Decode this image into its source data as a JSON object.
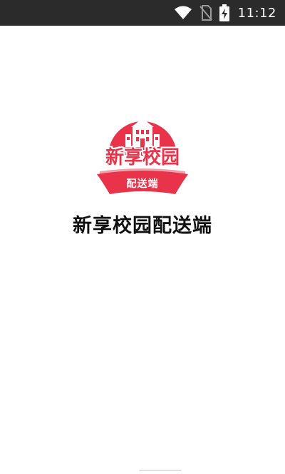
{
  "status_bar": {
    "time": "11:12",
    "icons": [
      "wifi-icon",
      "no-sim-icon",
      "battery-charging-icon"
    ]
  },
  "logo": {
    "main_text": "新享校园",
    "sub_text": "配送端",
    "icon": "school-building-icon",
    "colors": {
      "primary": "#e8334a",
      "light": "#f2a0aa"
    }
  },
  "app": {
    "name": "新享校园配送端"
  }
}
